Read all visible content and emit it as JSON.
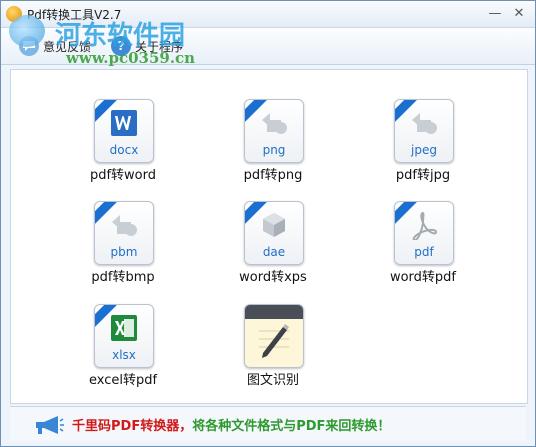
{
  "window": {
    "title": "Pdf转换工具V2.7",
    "minimize": "—",
    "close": "✕"
  },
  "watermark": {
    "site": "河东软件园",
    "url": "www.pc0359.cn"
  },
  "toolbar": {
    "feedback_label": "意见反馈",
    "feedback_icon": "feedback-icon",
    "about_label": "关于程序",
    "about_icon": "question-icon",
    "about_icon_glyph": "?"
  },
  "tools": [
    {
      "label": "pdf转word",
      "ext": "docx",
      "icon": "word-icon"
    },
    {
      "label": "pdf转png",
      "ext": "png",
      "icon": "image-icon"
    },
    {
      "label": "pdf转jpg",
      "ext": "jpeg",
      "icon": "image-icon"
    },
    {
      "label": "pdf转bmp",
      "ext": "pbm",
      "icon": "image-icon"
    },
    {
      "label": "word转xps",
      "ext": "dae",
      "icon": "cube-icon"
    },
    {
      "label": "word转pdf",
      "ext": "pdf",
      "icon": "acrobat-icon"
    },
    {
      "label": "excel转pdf",
      "ext": "xlsx",
      "icon": "excel-icon"
    },
    {
      "label": "图文识别",
      "ext": "",
      "icon": "notepad-icon"
    }
  ],
  "footer": {
    "red_text": "千里码PDF转换器，",
    "green_text": "将各种文件格式与PDF来回转换！",
    "icon": "megaphone-icon"
  }
}
